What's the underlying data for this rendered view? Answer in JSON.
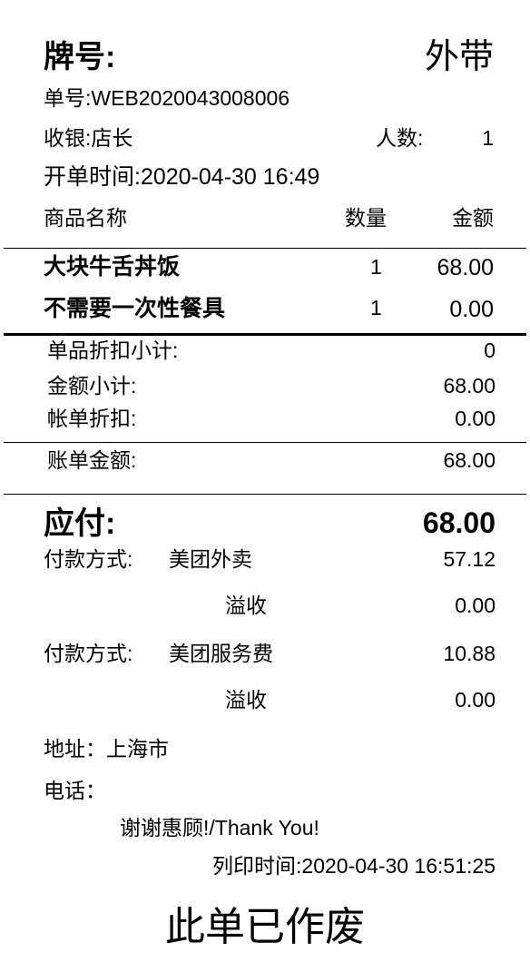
{
  "header": {
    "plate_label": "牌号:",
    "order_type": "外带"
  },
  "info": {
    "order_no": "单号:WEB2020043008006",
    "cashier": "收银:店长",
    "guests_label": "人数:",
    "guests": "1",
    "open_time": "开单时间:2020-04-30 16:49"
  },
  "columns": {
    "name": "商品名称",
    "qty": "数量",
    "amount": "金额"
  },
  "items": [
    {
      "name": "大块牛舌丼饭",
      "qty": "1",
      "amount": "68.00"
    },
    {
      "name": "不需要一次性餐具",
      "qty": "1",
      "amount": "0.00"
    }
  ],
  "summary": [
    {
      "label": "单品折扣小计:",
      "value": "0"
    },
    {
      "label": "金额小计:",
      "value": "68.00"
    },
    {
      "label": "帐单折扣:",
      "value": "0.00"
    }
  ],
  "bill_total": {
    "label": "账单金额:",
    "value": "68.00"
  },
  "payable": {
    "label": "应付:",
    "value": "68.00"
  },
  "payments": [
    {
      "label": "付款方式:",
      "method": "美团外卖",
      "amount": "57.12",
      "overflow_label": "溢收",
      "overflow": "0.00"
    },
    {
      "label": "付款方式:",
      "method": "美团服务费",
      "amount": "10.88",
      "overflow_label": "溢收",
      "overflow": "0.00"
    }
  ],
  "footer": {
    "address": "地址：上海市",
    "phone": "电话：",
    "thanks": "谢谢惠顾!/Thank You!",
    "print_time": "列印时间:2020-04-30 16:51:25",
    "void_notice": "此单已作废"
  }
}
